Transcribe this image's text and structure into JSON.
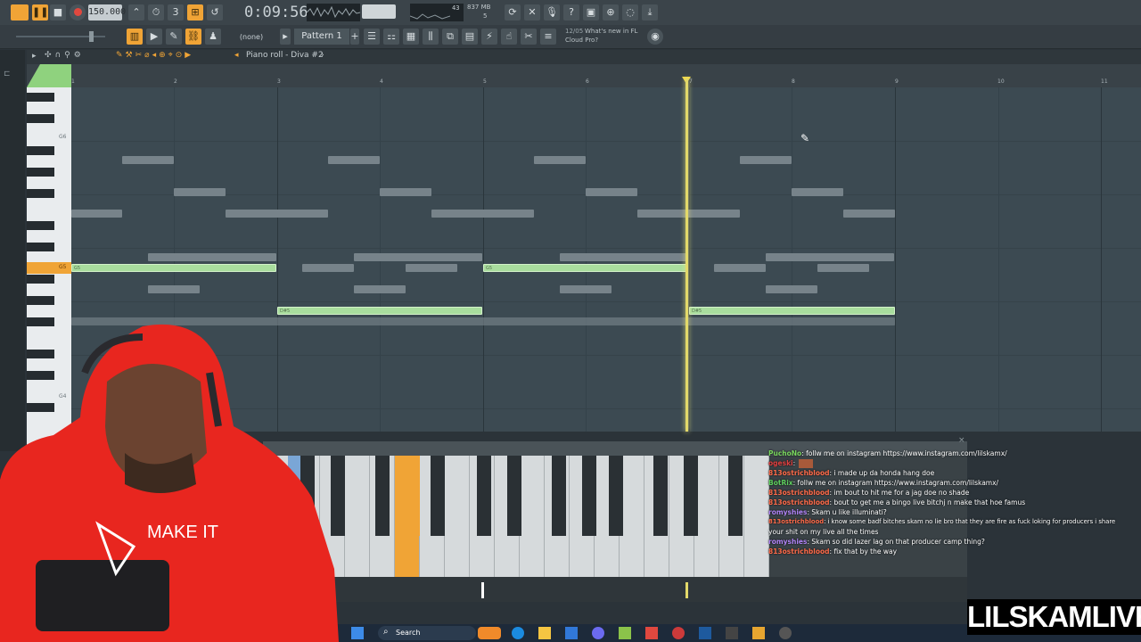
{
  "transport": {
    "tempo": "150.000",
    "time": "0:09:56",
    "cpu": "43",
    "memory": "837 MB",
    "voices": "5",
    "pattern": "Pattern 1",
    "none_label": "(none)",
    "news_date": "12/05",
    "news_title": "What's new in FL",
    "news_sub": "Cloud Pro?"
  },
  "piano_roll": {
    "title": "Piano roll - Diva #2",
    "bar_numbers": [
      "1",
      "2",
      "3",
      "4",
      "5",
      "6",
      "7",
      "8",
      "9",
      "10",
      "11"
    ],
    "key_labels": {
      "g6": "G6",
      "g5": "G5",
      "g4": "G4"
    },
    "note_labels": {
      "g5": "G5",
      "ds5": "D#5"
    }
  },
  "chat": [
    {
      "user": "PuchoNo",
      "user_color": "#7ad85f",
      "text": ": follw me on instagram https://www.instagram.com/lilskamx/"
    },
    {
      "user": "ogeski",
      "user_color": "#e04040",
      "text": ":"
    },
    {
      "user": "813ostrichblood",
      "user_color": "#ff6b4a",
      "text": ": i made up da honda hang doe"
    },
    {
      "user": "BotRix",
      "user_color": "#5fcf5f",
      "text": ": follw me on instagram https://www.instagram.com/lilskamx/"
    },
    {
      "user": "813ostrichblood",
      "user_color": "#ff6b4a",
      "text": ": im bout to hit me for a jag doe no shade"
    },
    {
      "user": "813ostrichblood",
      "user_color": "#ff6b4a",
      "text": ": bout to get me a bingo live bitchj n make that hoe famus"
    },
    {
      "user": "romyshies",
      "user_color": "#b084f5",
      "text": ": Skam u like illuminati?"
    },
    {
      "user": "813ostrichblood",
      "user_color": "#ff6b4a",
      "text": ": i know some badf bitches skam no lie bro that they are fire as fuck loking for producers i share"
    },
    {
      "user": "",
      "user_color": "#ffffff",
      "text": "your shit on my live all the times"
    },
    {
      "user": "romyshies",
      "user_color": "#b084f5",
      "text": ": Skam so did lazer lag on that producer camp thing?"
    },
    {
      "user": "813ostrichblood",
      "user_color": "#ff6b4a",
      "text": ": fix that by the way"
    }
  ],
  "taskbar": {
    "search_label": "Search"
  },
  "watermark": "LILSKAMLIVE",
  "hoodie_text": "MAKE IT",
  "colors": {
    "accent": "#f0a436",
    "note": "#a9dd9e",
    "playhead": "#e3d96a",
    "hoodie": "#e8261f"
  }
}
